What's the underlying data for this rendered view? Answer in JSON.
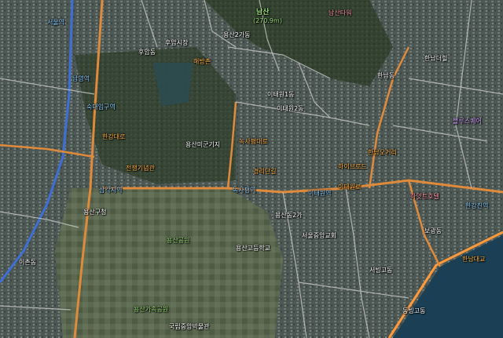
{
  "colors": {
    "road_major": "#e08a3c",
    "road_minor": "#c9c9c9",
    "river": "#1d4b63",
    "river_edge": "#ff9a3c",
    "park_dark": "#3c4a33",
    "military_base": "#5b6a4c",
    "urban": "#4f5a55",
    "subway_blue": "#3d6fd6"
  },
  "labels": [
    {
      "text": "남산",
      "cls": "green big",
      "icon": "mountain-icon"
    },
    {
      "text": "(270.9m)",
      "cls": "green"
    },
    {
      "text": "후암동",
      "cls": ""
    },
    {
      "text": "용산2가동",
      "cls": ""
    },
    {
      "text": "해방촌",
      "cls": "orange"
    },
    {
      "text": "이태원1동",
      "cls": ""
    },
    {
      "text": "이태원2동",
      "cls": ""
    },
    {
      "text": "한남동",
      "cls": ""
    },
    {
      "text": "한남오거리",
      "cls": "orange"
    },
    {
      "text": "한남더힐",
      "cls": ""
    },
    {
      "text": "보광동",
      "cls": ""
    },
    {
      "text": "서빙고동",
      "cls": ""
    },
    {
      "text": "용산공원",
      "cls": "green"
    },
    {
      "text": "용산가족공원",
      "cls": "green"
    },
    {
      "text": "국립중앙박물관",
      "cls": ""
    },
    {
      "text": "삼각지역",
      "cls": "blue"
    },
    {
      "text": "녹사평역",
      "cls": "blue"
    },
    {
      "text": "이태원역",
      "cls": "blue"
    },
    {
      "text": "한강진역",
      "cls": "blue"
    },
    {
      "text": "숙대입구역",
      "cls": "blue"
    },
    {
      "text": "서울역",
      "cls": "blue"
    },
    {
      "text": "남영역",
      "cls": "blue"
    },
    {
      "text": "전쟁기념관",
      "cls": "orange"
    },
    {
      "text": "이태원로",
      "cls": "orange"
    },
    {
      "text": "녹사평대로",
      "cls": "orange"
    },
    {
      "text": "한강대로",
      "cls": "orange"
    },
    {
      "text": "용산구청",
      "cls": ""
    },
    {
      "text": "경리단길",
      "cls": "orange"
    },
    {
      "text": "하얏트호텔",
      "cls": "pink"
    },
    {
      "text": "블루스퀘어",
      "cls": "purple"
    },
    {
      "text": "한남대교",
      "cls": "orange"
    },
    {
      "text": "후암시장",
      "cls": ""
    },
    {
      "text": "용산미군기지",
      "cls": ""
    },
    {
      "text": "남산타워",
      "cls": "pink"
    },
    {
      "text": "하이브로드",
      "cls": "orange"
    },
    {
      "text": "서울중앙교회",
      "cls": ""
    },
    {
      "text": "용산고등학교",
      "cls": ""
    },
    {
      "text": "이촌동",
      "cls": ""
    },
    {
      "text": "동빙고동",
      "cls": ""
    },
    {
      "text": "용산동2가",
      "cls": ""
    }
  ],
  "zoom": {
    "level": "15"
  }
}
